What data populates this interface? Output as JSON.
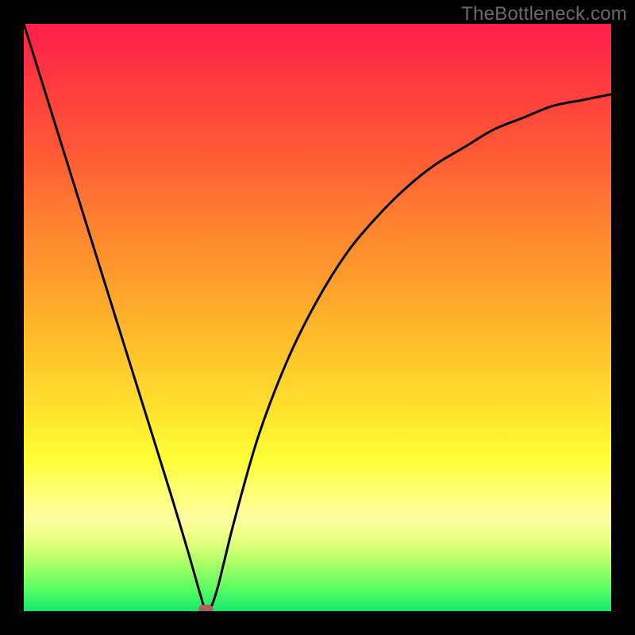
{
  "watermark": "TheBottleneck.com",
  "colors": {
    "gradient_top": "#ff1e4c",
    "gradient_bottom": "#16e86c",
    "frame": "#000000",
    "curve": "#000000",
    "marker": "#b55a5f"
  },
  "chart_data": {
    "type": "line",
    "title": "",
    "xlabel": "",
    "ylabel": "",
    "xlim": [
      0,
      100
    ],
    "ylim": [
      0,
      100
    ],
    "grid": false,
    "legend": false,
    "annotations": [],
    "series": [
      {
        "name": "curve",
        "x": [
          0,
          5,
          10,
          15,
          20,
          25,
          28,
          30,
          31,
          32,
          33,
          34,
          36,
          40,
          45,
          50,
          55,
          60,
          65,
          70,
          75,
          80,
          85,
          90,
          95,
          100
        ],
        "y": [
          100,
          84,
          68,
          52,
          36,
          20,
          10,
          3,
          0,
          1,
          4,
          8,
          16,
          30,
          43,
          53,
          61,
          67,
          72,
          76,
          79,
          82,
          84,
          86,
          87,
          88
        ]
      }
    ],
    "marker": {
      "x": 31,
      "y": 0,
      "shape": "rounded-rect"
    }
  }
}
